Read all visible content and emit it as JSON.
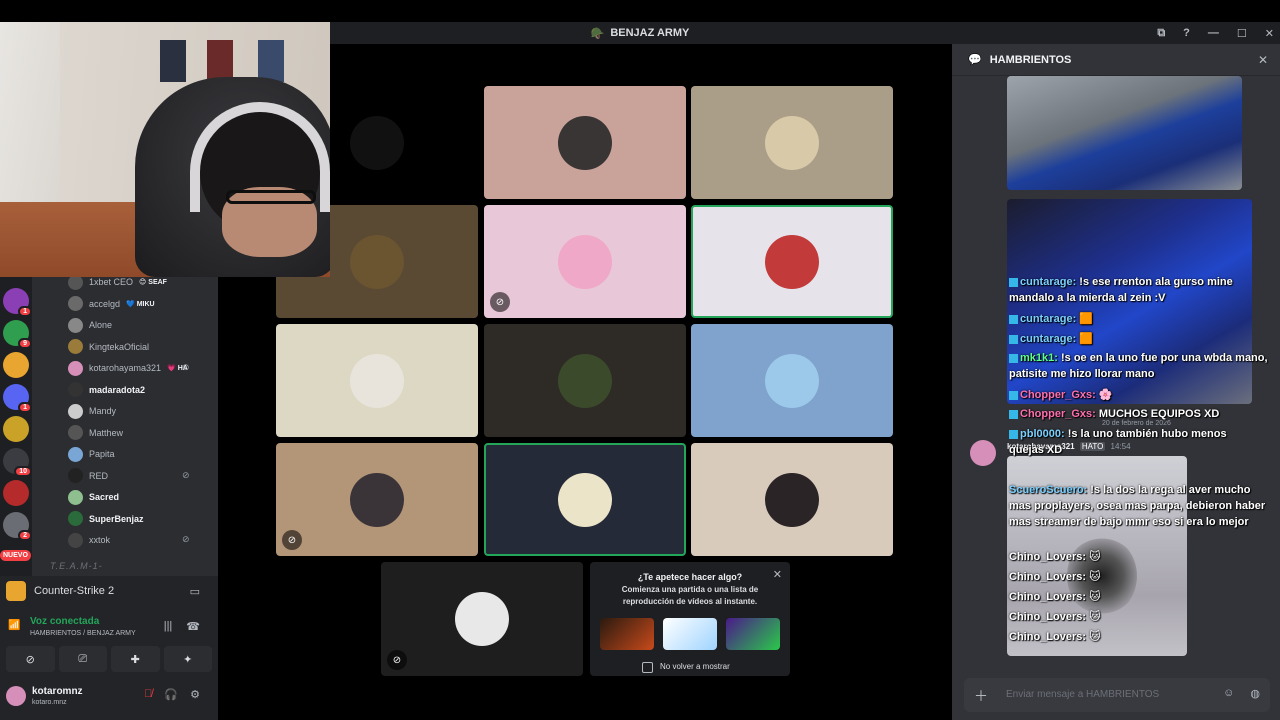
{
  "window": {
    "title": "BENJAZ ARMY",
    "controls": [
      "⧉",
      "?",
      "—",
      "☐",
      "✕"
    ]
  },
  "servers": [
    {
      "badge": "1",
      "color": "#8b3fb5"
    },
    {
      "badge": "9",
      "color": "#2f9e4f"
    },
    {
      "badge": "",
      "color": "#e8a530"
    },
    {
      "badge": "1",
      "color": "#5865f2"
    },
    {
      "badge": "",
      "color": "#c9a227"
    },
    {
      "badge": "10",
      "color": "#3a3c42"
    },
    {
      "badge": "",
      "color": "#b52a2a"
    },
    {
      "badge": "2",
      "color": "#6a6e74"
    }
  ],
  "new_label": "NUEVO",
  "members": [
    {
      "name": "1xbet CEO",
      "tag": "😊 SEAF",
      "bold": false,
      "muted": false,
      "color": "#555"
    },
    {
      "name": "accelgd",
      "tag": "💙 MIKU",
      "bold": false,
      "muted": false,
      "color": "#6a6a6a"
    },
    {
      "name": "Alone",
      "tag": "",
      "bold": false,
      "muted": false,
      "color": "#888"
    },
    {
      "name": "KingtekaOficial",
      "tag": "",
      "bold": false,
      "muted": false,
      "color": "#9a7b3a"
    },
    {
      "name": "kotarohayama321",
      "tag": "💗 HA",
      "bold": false,
      "muted": true,
      "color": "#d68fb8"
    },
    {
      "name": "madaradota2",
      "tag": "",
      "bold": true,
      "muted": false,
      "color": "#333"
    },
    {
      "name": "Mandy",
      "tag": "",
      "bold": false,
      "muted": false,
      "color": "#ccc"
    },
    {
      "name": "Matthew",
      "tag": "",
      "bold": false,
      "muted": false,
      "color": "#555"
    },
    {
      "name": "Papita",
      "tag": "",
      "bold": false,
      "muted": false,
      "color": "#7aa6d6"
    },
    {
      "name": "RED",
      "tag": "",
      "bold": false,
      "muted": true,
      "color": "#222"
    },
    {
      "name": "Sacred",
      "tag": "",
      "bold": true,
      "muted": false,
      "color": "#8fbf8f"
    },
    {
      "name": "SuperBenjaz",
      "tag": "",
      "bold": true,
      "muted": false,
      "color": "#2b6b3b"
    },
    {
      "name": "xxtok",
      "tag": "",
      "bold": false,
      "muted": true,
      "color": "#444"
    }
  ],
  "team_label": "T.E.A.M-1-",
  "game": {
    "name": "Counter-Strike 2",
    "icon": "monitor-icon"
  },
  "voice": {
    "status": "Voz conectada",
    "location": "HAMBRIENTOS / BENJAZ ARMY"
  },
  "user": {
    "name": "kotaromnz",
    "handle": "kotaro.mnz"
  },
  "tiles": [
    {
      "bg": "#000000",
      "face": "#111111",
      "muted": false,
      "active": false
    },
    {
      "bg": "#c9a39a",
      "face": "#3a3535",
      "muted": false,
      "active": false
    },
    {
      "bg": "#aa9e88",
      "face": "#d8c9a8",
      "muted": false,
      "active": false
    },
    {
      "bg": "#5a4a34",
      "face": "#6b5430",
      "muted": false,
      "active": false
    },
    {
      "bg": "#e8c8d8",
      "face": "#f0a8c8",
      "muted": true,
      "active": false
    },
    {
      "bg": "#e6e4ea",
      "face": "#c23a3a",
      "muted": false,
      "active": true
    },
    {
      "bg": "#dcd8c4",
      "face": "#e8e4dc",
      "muted": false,
      "active": false
    },
    {
      "bg": "#2e2a26",
      "face": "#3a4a2a",
      "muted": false,
      "active": false
    },
    {
      "bg": "#7fa3cc",
      "face": "#9cc8ea",
      "muted": false,
      "active": false
    },
    {
      "bg": "#b39578",
      "face": "#3a3438",
      "muted": true,
      "active": false
    },
    {
      "bg": "#252a38",
      "face": "#ece4c8",
      "muted": false,
      "active": true
    },
    {
      "bg": "#d9cbbb",
      "face": "#2a2426",
      "muted": false,
      "active": false
    }
  ],
  "bottom_tile": {
    "bg": "#1e1e1e",
    "face": "#e8e8e8"
  },
  "promo": {
    "title": "¿Te apetece hacer algo?",
    "desc": "Comienza una partida o una lista de reproducción de vídeos al instante.",
    "checkbox_label": "No volver a mostrar"
  },
  "chat": {
    "channel": "HAMBRIENTOS",
    "date_divider": "20 de febrero de 2026",
    "msg_author": "kotarohayama321",
    "msg_tag": "HATO",
    "msg_time": "14:54",
    "placeholder": "Enviar mensaje a HAMBRIENTOS",
    "overlay_lines": [
      {
        "name": "cuntarage:",
        "text": " !s ese rrenton ala gurso mine",
        "cls": ""
      },
      {
        "name": "",
        "text": "mandalo a la mierda al zein :V",
        "cls": ""
      },
      {
        "name": "cuntarage:",
        "text": " 🟧",
        "cls": ""
      },
      {
        "name": "cuntarage:",
        "text": " 🟧",
        "cls": ""
      },
      {
        "name": "mk1k1:",
        "text": " !s oe en la uno fue por una wbda mano,",
        "cls": "green"
      },
      {
        "name": "",
        "text": "patisite me hizo llorar mano",
        "cls": ""
      },
      {
        "name": "Chopper_Gxs:",
        "text": " 🌸",
        "cls": "pink"
      },
      {
        "name": "Chopper_Gxs:",
        "text": " MUCHOS EQUIPOS XD",
        "cls": "pink"
      },
      {
        "name": "pbl0000:",
        "text": " !s la uno también hubo menos",
        "cls": ""
      },
      {
        "name": "",
        "text": "quejas XD",
        "cls": ""
      }
    ],
    "block_name": "ScueroScuero:",
    "block_text": " !s la dos la rega al aver mucho mas proplayers, osea mas parpa, debieron haber mas streamer de bajo mmr eso si era lo mejor",
    "chino_lines": [
      "Chino_Lovers:",
      "Chino_Lovers:",
      "Chino_Lovers:",
      "Chino_Lovers:",
      "Chino_Lovers:"
    ]
  }
}
